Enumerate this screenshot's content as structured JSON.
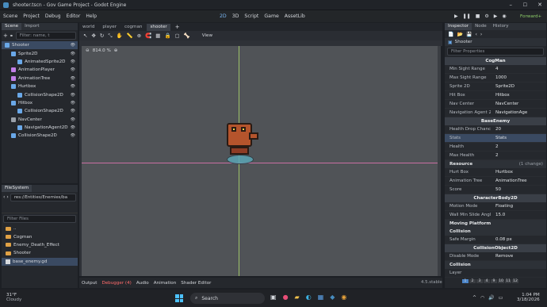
{
  "window": {
    "title": "shooter.tscn - Gov Game Project - Godot Engine"
  },
  "menu": [
    "Scene",
    "Project",
    "Debug",
    "Editor",
    "Help"
  ],
  "workspaces": [
    "2D",
    "3D",
    "Script",
    "Game",
    "AssetLib"
  ],
  "renderer": "Forward+",
  "scene_dock": {
    "tabs": [
      "Scene",
      "Import"
    ],
    "filter_placeholder": "Filter: name, t",
    "nodes": [
      {
        "label": "Shooter",
        "indent": 0,
        "color": "#6aa8e8"
      },
      {
        "label": "Sprite2D",
        "indent": 1,
        "color": "#6aa8e8"
      },
      {
        "label": "AnimatedSprite2D",
        "indent": 2,
        "color": "#6aa8e8"
      },
      {
        "label": "AnimationPlayer",
        "indent": 1,
        "color": "#c27ee8"
      },
      {
        "label": "AnimationTree",
        "indent": 1,
        "color": "#c27ee8"
      },
      {
        "label": "Hurtbox",
        "indent": 1,
        "color": "#6aa8e8"
      },
      {
        "label": "CollisionShape2D",
        "indent": 2,
        "color": "#6aa8e8"
      },
      {
        "label": "Hitbox",
        "indent": 1,
        "color": "#6aa8e8"
      },
      {
        "label": "CollisionShape2D",
        "indent": 2,
        "color": "#6aa8e8"
      },
      {
        "label": "NavCenter",
        "indent": 1,
        "color": "#9aa0a8"
      },
      {
        "label": "NavigationAgent2D",
        "indent": 2,
        "color": "#6aa8e8"
      },
      {
        "label": "CollisionShape2D",
        "indent": 1,
        "color": "#6aa8e8"
      }
    ]
  },
  "filesystem": {
    "title": "FileSystem",
    "path": "res://Entities/Enemies/ba",
    "filter_placeholder": "Filter Files",
    "items": [
      {
        "label": "..",
        "type": "folder"
      },
      {
        "label": "Cogman",
        "type": "folder"
      },
      {
        "label": "Enemy_Death_Effect",
        "type": "folder"
      },
      {
        "label": "Shooter",
        "type": "folder"
      },
      {
        "label": "base_enemy.gd",
        "type": "script"
      }
    ]
  },
  "editor_tabs": [
    "world",
    "player",
    "cogman",
    "shooter"
  ],
  "viewport": {
    "zoom": "814.0 %",
    "view_label": "View"
  },
  "bottom_tabs": [
    "Output",
    "Debugger (4)",
    "Audio",
    "Animation",
    "Shader Editor"
  ],
  "version": "4.5.stable",
  "inspector": {
    "tabs": [
      "Inspector",
      "Node",
      "History"
    ],
    "node": "Shooter",
    "filter_placeholder": "Filter Properties",
    "sections": [
      {
        "type": "section",
        "label": "CogMan"
      },
      {
        "type": "row",
        "k": "Min Sight Range",
        "v": "4"
      },
      {
        "type": "row",
        "k": "Max Sight Range",
        "v": "1000"
      },
      {
        "type": "row",
        "k": "Sprite 2D",
        "v": "Sprite2D"
      },
      {
        "type": "row",
        "k": "Hit Box",
        "v": "Hitbox"
      },
      {
        "type": "row",
        "k": "Nav Center",
        "v": "NavCenter"
      },
      {
        "type": "row",
        "k": "Navigation Agent 2",
        "v": "NavigationAge"
      },
      {
        "type": "section",
        "label": "BaseEnemy"
      },
      {
        "type": "row",
        "k": "Health Drop Chance",
        "v": "20"
      },
      {
        "type": "row",
        "k": "Stats",
        "v": "Stats"
      },
      {
        "type": "row",
        "k": "Health",
        "v": "2"
      },
      {
        "type": "row",
        "k": "Max Health",
        "v": "2"
      },
      {
        "type": "subsec",
        "label": "Resource",
        "note": "(1 change)"
      },
      {
        "type": "row",
        "k": "Hurt Box",
        "v": "Hurtbox"
      },
      {
        "type": "row",
        "k": "Animation Tree",
        "v": "AnimationTree"
      },
      {
        "type": "row",
        "k": "Score",
        "v": "50"
      },
      {
        "type": "section",
        "label": "CharacterBody2D"
      },
      {
        "type": "row",
        "k": "Motion Mode",
        "v": "Floating"
      },
      {
        "type": "row",
        "k": "Wall Min Slide Angle",
        "v": "15.0"
      },
      {
        "type": "subsec",
        "label": "Moving Platform"
      },
      {
        "type": "subsec",
        "label": "Collision"
      },
      {
        "type": "row",
        "k": "Safe Margin",
        "v": "0.08 px"
      },
      {
        "type": "section",
        "label": "CollisionObject2D"
      },
      {
        "type": "row",
        "k": "Disable Mode",
        "v": "Remove"
      },
      {
        "type": "subsec",
        "label": "Collision"
      },
      {
        "type": "row",
        "k": "Layer",
        "v": ""
      }
    ],
    "layer_numbers": [
      "1",
      "2",
      "3",
      "4",
      "9",
      "10",
      "11",
      "12"
    ]
  },
  "taskbar": {
    "weather_temp": "31°F",
    "weather_desc": "Cloudy",
    "search": "Search",
    "time": "1:04 PM",
    "date": "3/18/2026"
  }
}
